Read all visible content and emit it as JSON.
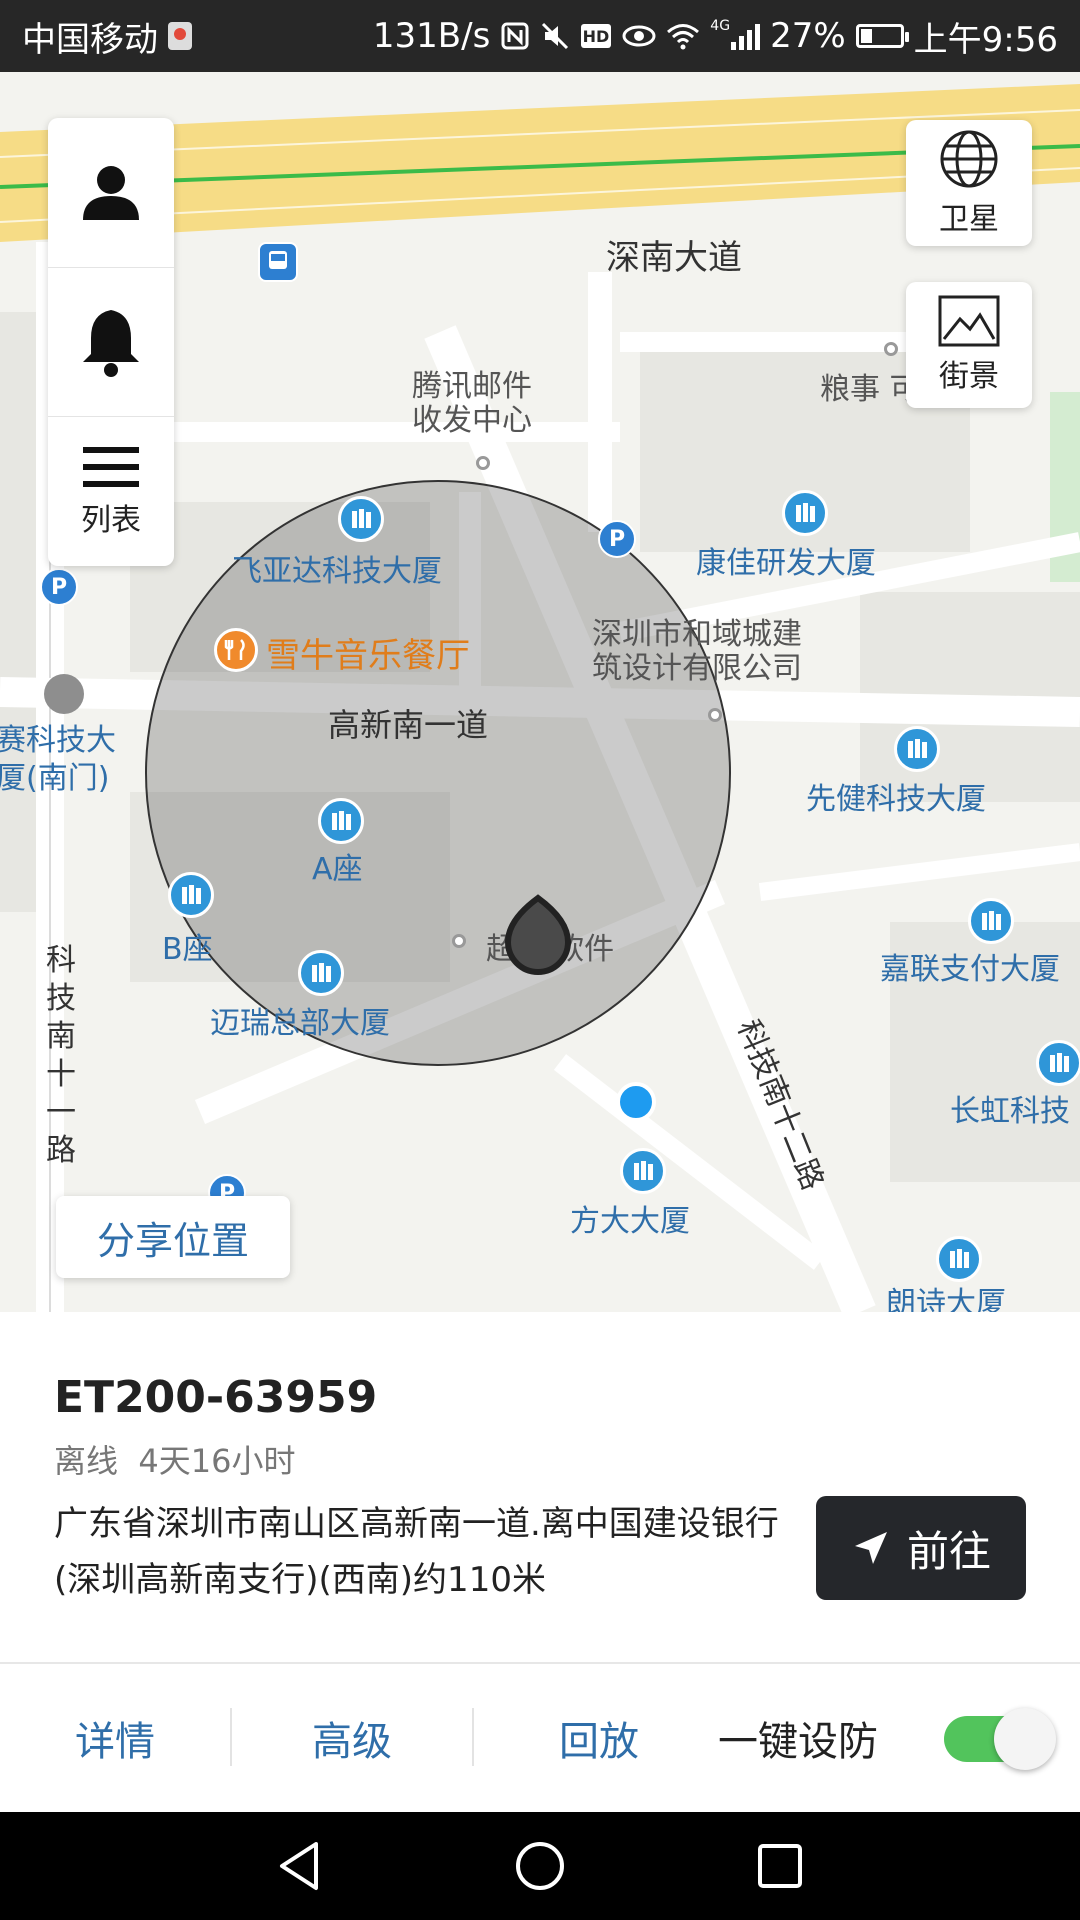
{
  "status_bar": {
    "carrier": "中国移动",
    "speed": "131B/s",
    "network": "4G",
    "battery": "27%",
    "time": "上午9:56"
  },
  "map": {
    "road_main": "深南大道",
    "road_gaoxin": "高新南一道",
    "road_keji12": "科技南十二路",
    "road_keji11": "科技南十一路",
    "pois": {
      "tencent": "腾讯邮件\n收发中心",
      "feiyada": "飞亚达科技大厦",
      "kangjia": "康佳研发大厦",
      "xueniu": "雪牛音乐餐厅",
      "heyu": "深圳市和域城建\n筑设计有限公司",
      "saisai": "赛科技大\n厦(南门)",
      "xianjian": "先健科技大厦",
      "a_zuo": "A座",
      "b_zuo": "B座",
      "chao": "超    软件",
      "jialian": "嘉联支付大厦",
      "mairui": "迈瑞总部大厦",
      "changhong": "长虹科技",
      "fangda": "方大大厦",
      "langshi": "朗诗大厦",
      "cushi": "粮事 可"
    },
    "buttons": {
      "satellite": "卫星",
      "street_view": "街景",
      "list": "列表",
      "share": "分享位置"
    }
  },
  "device": {
    "name": "ET200-63959",
    "status": "离线",
    "duration": "4天16小时",
    "address": "广东省深圳市南山区高新南一道.离中国建设银行(深圳高新南支行)(西南)约110米",
    "go_label": "前往"
  },
  "actions": {
    "details": "详情",
    "advanced": "高级",
    "playback": "回放",
    "arm_label": "一键设防",
    "arm_on": true
  },
  "colors": {
    "accent_blue": "#2f6ea9",
    "toggle_green": "#52c45c",
    "go_button": "#25272b"
  }
}
